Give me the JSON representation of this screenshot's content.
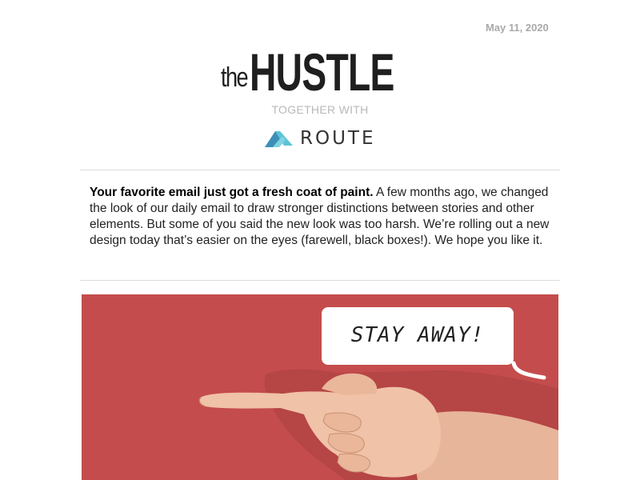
{
  "header": {
    "date": "May 11, 2020",
    "logo_small": "the",
    "logo_large": "HUSTLE",
    "together_with": "TOGETHER WITH",
    "sponsor_name": "ROUTE",
    "sponsor_icon": "route-logo-icon"
  },
  "intro": {
    "lead_bold": "Your favorite email just got a fresh coat of paint.",
    "body": " A few months ago, we changed the look of our daily email to draw stronger distinctions between stories and other elements. But some of you said the new look was too harsh. We’re rolling out a new design today that’s easier on the eyes (farewell, black boxes!). We hope you like it."
  },
  "hero": {
    "speech_bubble_text": "STAY AWAY!",
    "background_color": "#c54c4c",
    "illustration": "pointing-hand-icon"
  },
  "colors": {
    "route_teal": "#5bc3d6",
    "route_blue": "#3d8fb8",
    "text": "#222222",
    "muted": "#a9a9a9"
  }
}
